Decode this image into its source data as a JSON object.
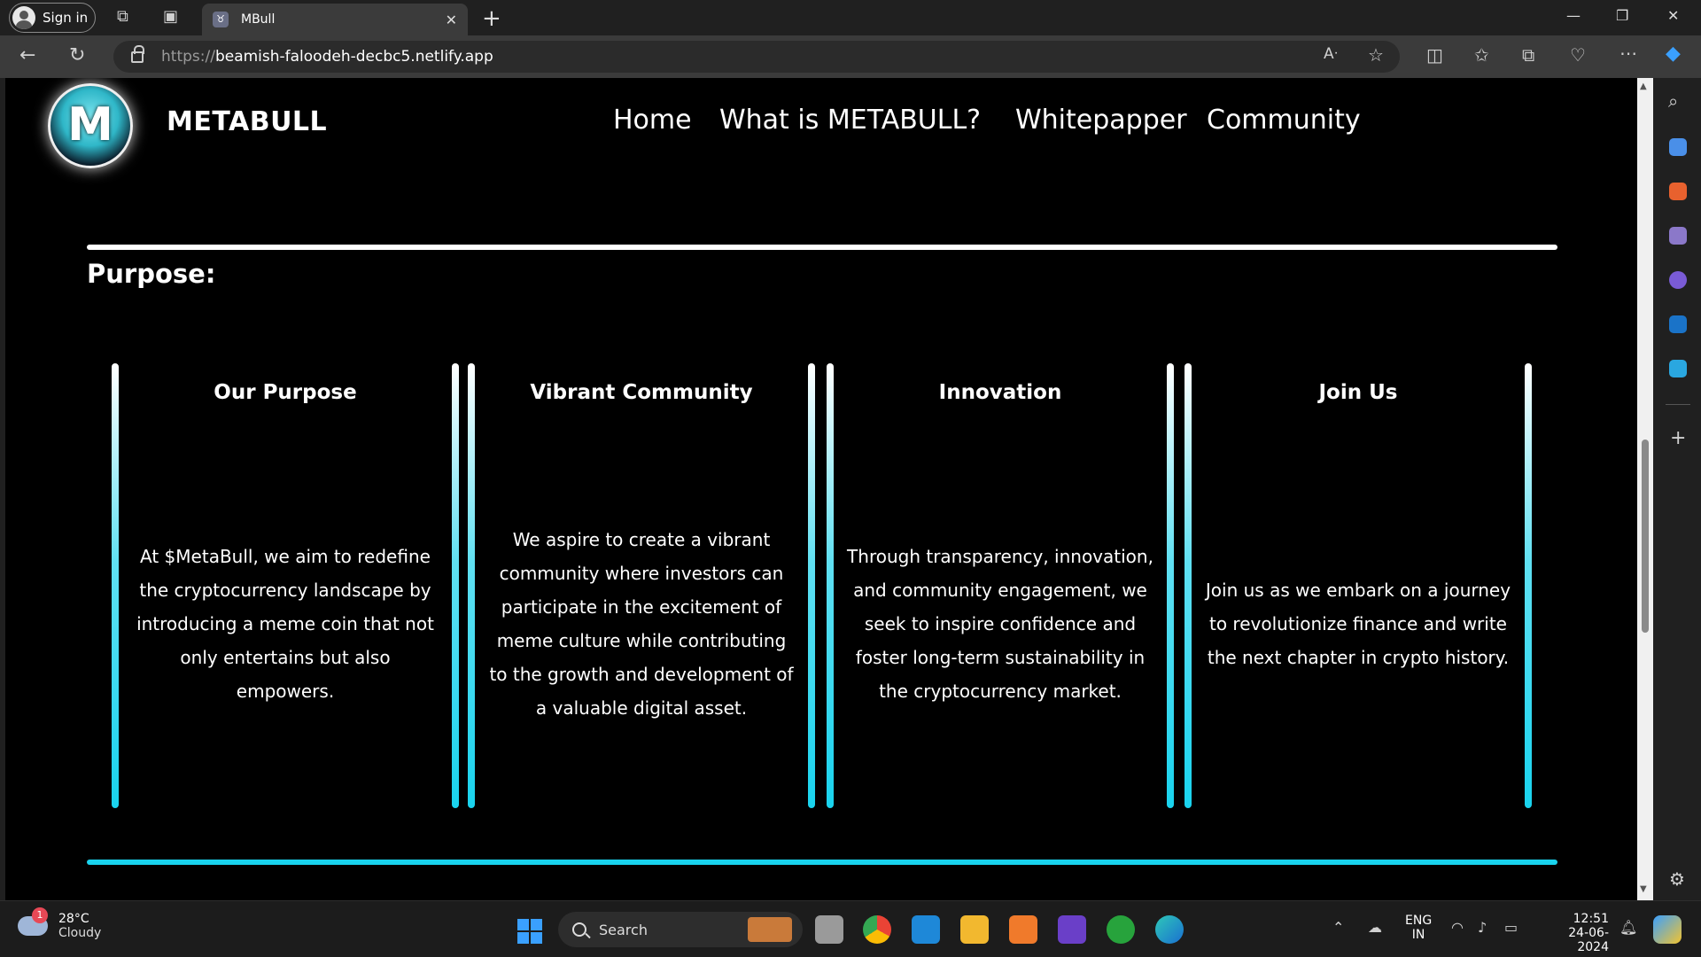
{
  "browser": {
    "signin_label": "Sign in",
    "tab_title": "MBull",
    "url_scheme": "https://",
    "url_host": "beamish-faloodeh-decbc5.netlify.app"
  },
  "site": {
    "brand": "METABULL",
    "nav": [
      "Home",
      "What is METABULL?",
      "Whitepapper",
      "Community"
    ],
    "section_title": "Purpose:",
    "cards": [
      {
        "title": "Our Purpose",
        "body": "At $MetaBull, we aim to redefine the cryptocurrency landscape by introducing a meme coin that not only entertains but also empowers."
      },
      {
        "title": "Vibrant Community",
        "body": "We aspire to create a vibrant community where investors can participate in the excitement of meme culture while contributing to the growth and development of a valuable digital asset."
      },
      {
        "title": "Innovation",
        "body": "Through transparency, innovation, and community engagement, we seek to inspire confidence and foster long-term sustainability in the cryptocurrency market."
      },
      {
        "title": "Join Us",
        "body": "Join us as we embark on a journey to revolutionize finance and write the next chapter in crypto history."
      }
    ],
    "accent_color": "#19d3ee"
  },
  "taskbar": {
    "weather_temp": "28°C",
    "weather_desc": "Cloudy",
    "weather_badge": "1",
    "search_label": "Search",
    "lang_top": "ENG",
    "lang_bottom": "IN",
    "time": "12:51",
    "date": "24-06-2024"
  }
}
